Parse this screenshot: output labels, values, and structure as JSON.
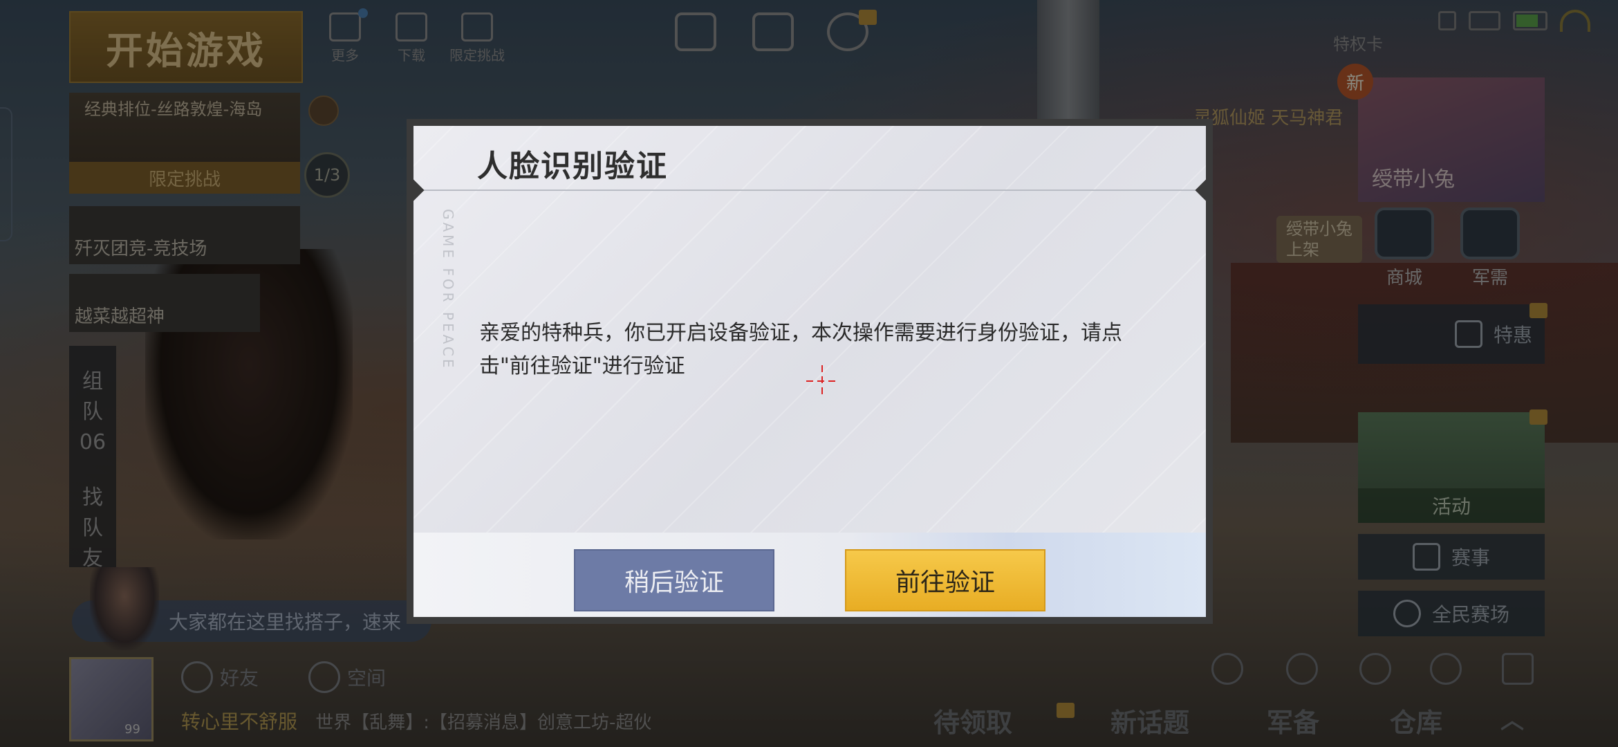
{
  "lobby": {
    "start_game": "开始游戏",
    "mode_title": "经典排位-丝路敦煌-海岛",
    "mode_sub": "限定挑战",
    "page_indicator": "1/3",
    "mode_card_1": "歼灭团竞-竞技场",
    "mode_card_2": "越菜越超神",
    "team_tab": "组队06",
    "find_tab": "找队友",
    "chat_placeholder": "大家都在这里找搭子，速来",
    "avatar_level": "99",
    "friends": "好友",
    "space": "空间",
    "player_name": "转心里不舒服",
    "world_message": "世界【乱舞】:【招募消息】创意工坊-超伙"
  },
  "top": {
    "more": "更多",
    "download": "下载",
    "limited": "限定挑战",
    "pass": "特权卡"
  },
  "right": {
    "names": "灵狐仙姬  天马神君",
    "new_badge": "新",
    "promo_label": "绶带小兔",
    "mini_promo": "绶带小兔\n上架",
    "shop": "商城",
    "armory": "军需",
    "special": "特惠",
    "activity": "活动",
    "match": "赛事",
    "arena": "全民赛场",
    "pending": "待领取",
    "topic": "新话题",
    "equipment": "军备",
    "warehouse": "仓库"
  },
  "dialog": {
    "title": "人脸识别验证",
    "watermark": "GAME FOR PEACE",
    "message": "亲爱的特种兵，你已开启设备验证，本次操作需要进行身份验证，请点击\"前往验证\"进行验证",
    "later_button": "稍后验证",
    "go_button": "前往验证"
  }
}
